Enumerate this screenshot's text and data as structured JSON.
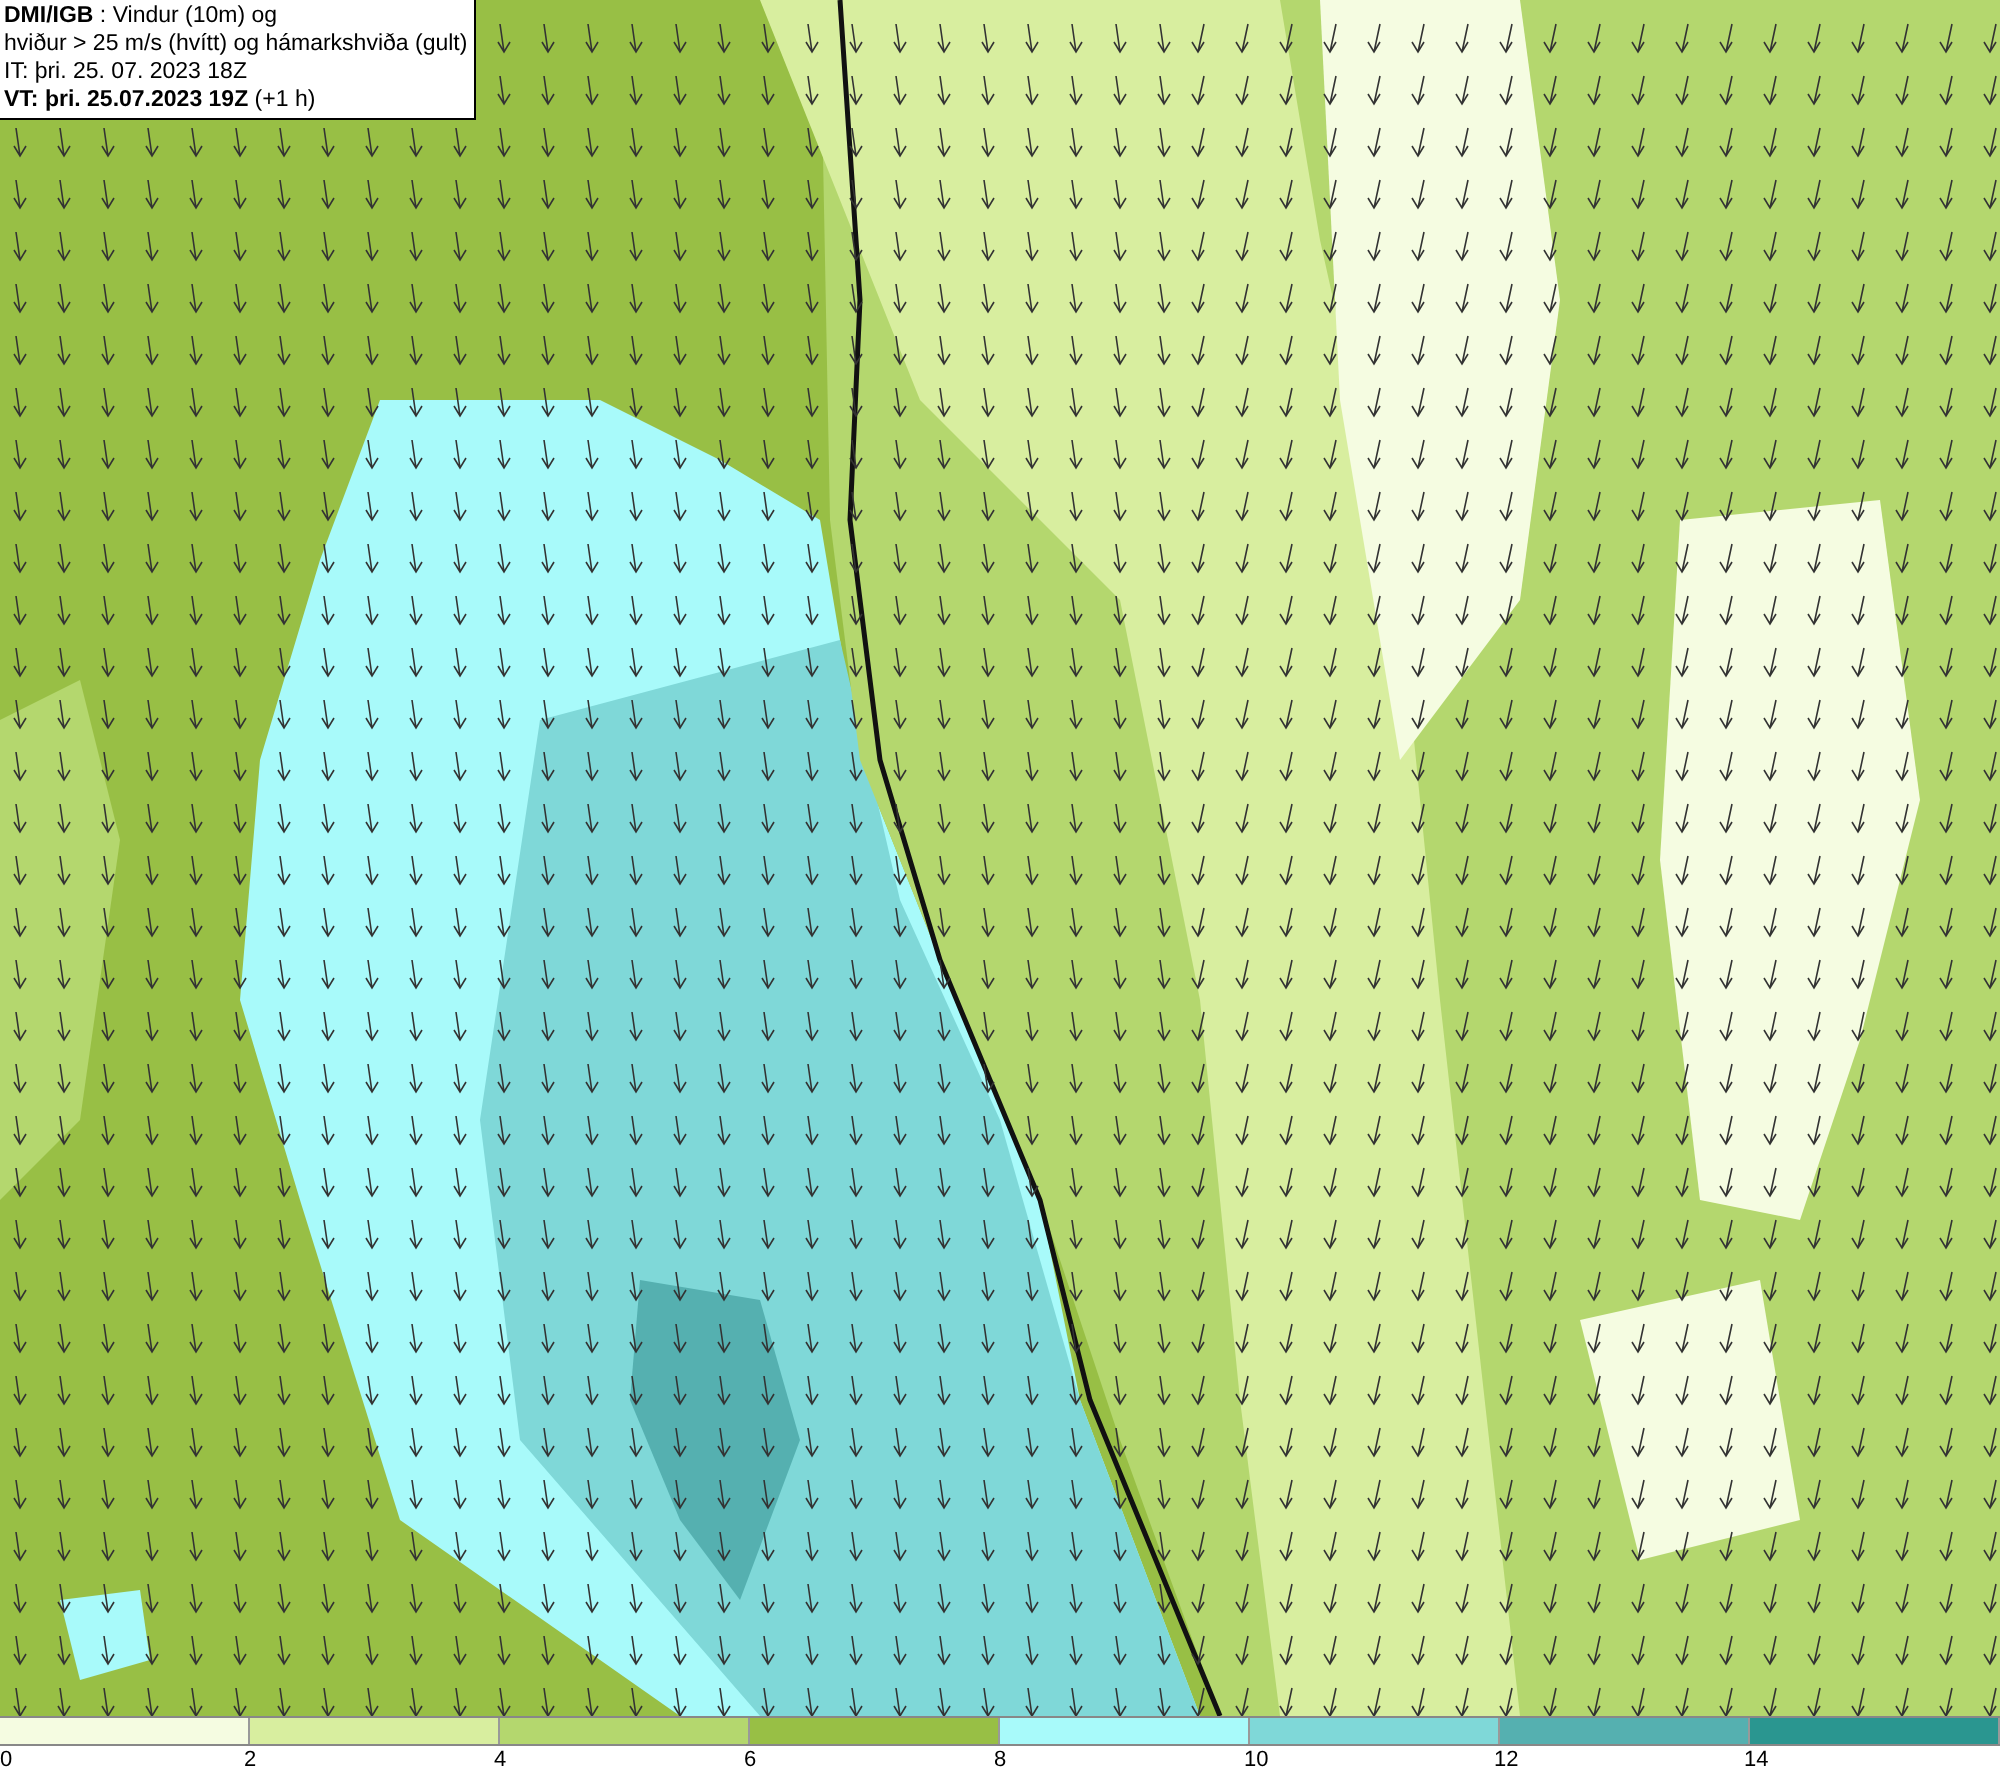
{
  "legend": {
    "lines": [
      "**DMI/IGB** : Vindur (10m) og",
      "hviður > 25 m/s (hvítt) og hámarkshviða (gult)",
      "IT: þri. 25. 07. 2023 18Z",
      "**VT: þri. 25.07.2023 19Z** (+1 h)"
    ]
  },
  "colorbar": {
    "bins": [
      {
        "color": "#f5fce1"
      },
      {
        "color": "#d8ee9f"
      },
      {
        "color": "#b4d76e"
      },
      {
        "color": "#98bf45"
      },
      {
        "color": "#a8fafa"
      },
      {
        "color": "#7fd8d8"
      },
      {
        "color": "#55b0b0"
      },
      {
        "color": "#2a9690"
      }
    ],
    "ticks": [
      "0",
      "2",
      "4",
      "6",
      "8",
      "10",
      "12",
      "14"
    ]
  }
}
